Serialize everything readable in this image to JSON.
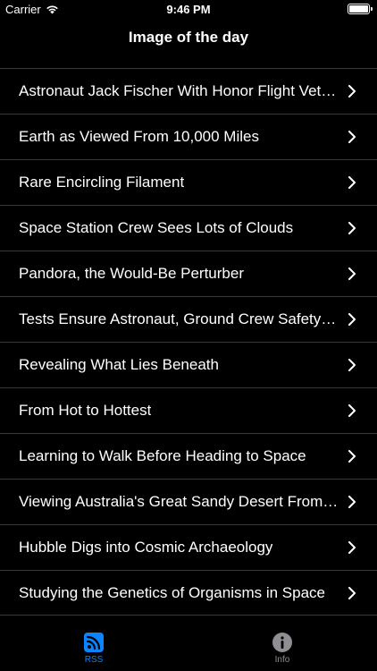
{
  "status_bar": {
    "carrier": "Carrier",
    "time": "9:46 PM"
  },
  "nav": {
    "title": "Image of the day"
  },
  "items": [
    "Astronaut Jack Fischer With Honor Flight Vet…",
    "Earth as Viewed From 10,000 Miles",
    "Rare Encircling Filament",
    "Space Station Crew Sees Lots of Clouds",
    "Pandora, the Would-Be Perturber",
    "Tests Ensure Astronaut, Ground Crew Safety…",
    "Revealing What Lies Beneath",
    "From Hot to Hottest",
    "Learning to Walk Before Heading to Space",
    "Viewing Australia's Great Sandy Desert From…",
    "Hubble Digs into Cosmic Archaeology",
    "Studying the Genetics of Organisms in Space"
  ],
  "tabs": {
    "rss": {
      "label": "RSS",
      "icon": "rss-icon",
      "color": "#0a84ff"
    },
    "info": {
      "label": "Info",
      "icon": "info-icon",
      "color": "#8e8e93"
    }
  }
}
